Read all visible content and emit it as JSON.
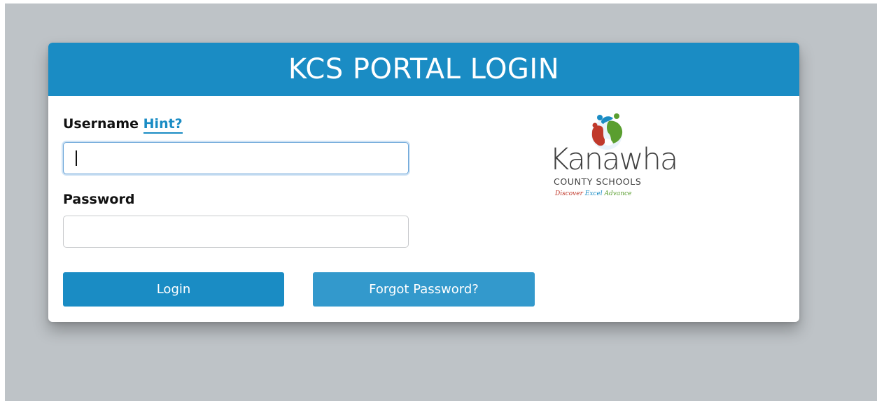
{
  "header": {
    "title": "KCS PORTAL LOGIN"
  },
  "username": {
    "label": "Username",
    "hint_link": "Hint?",
    "value": "",
    "placeholder": ""
  },
  "password": {
    "label": "Password",
    "value": "",
    "placeholder": ""
  },
  "buttons": {
    "login_label": "Login",
    "forgot_label": "Forgot Password?"
  },
  "logo": {
    "name": "Kanawha",
    "subtitle": "COUNTY SCHOOLS",
    "tagline_discover": "Discover",
    "tagline_excel": "Excel",
    "tagline_advance": "Advance"
  },
  "colors": {
    "brand_blue": "#1a8cc4",
    "button_secondary": "#3399cc",
    "page_background": "#bec3c7",
    "logo_red": "#c0392b",
    "logo_green": "#5a9e2f",
    "logo_blue": "#1a8cc4"
  },
  "icons": {
    "logo_mark": "globe-with-children-icon"
  }
}
